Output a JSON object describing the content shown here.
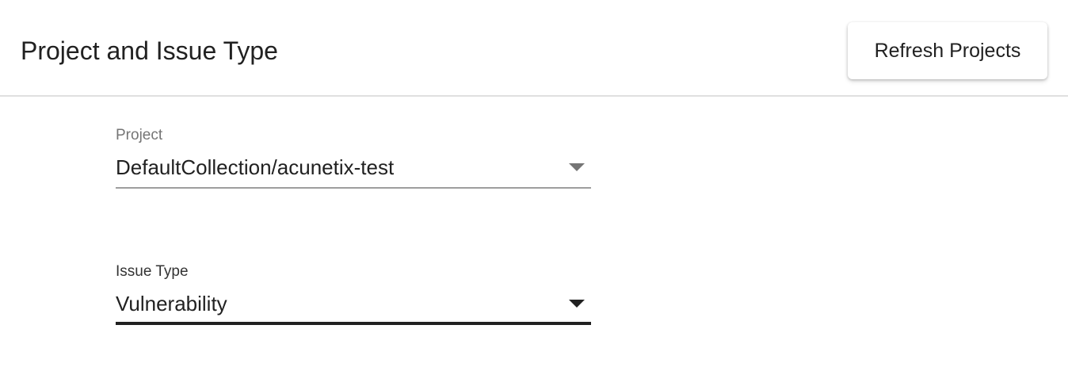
{
  "header": {
    "title": "Project and Issue Type",
    "refresh_button_label": "Refresh Projects"
  },
  "fields": {
    "project": {
      "label": "Project",
      "value": "DefaultCollection/acunetix-test"
    },
    "issue_type": {
      "label": "Issue Type",
      "value": "Vulnerability"
    }
  },
  "icons": {
    "dropdown": "caret-down-icon"
  },
  "colors": {
    "text": "#212121",
    "label_muted": "#757575",
    "divider": "#e0e0e0"
  }
}
